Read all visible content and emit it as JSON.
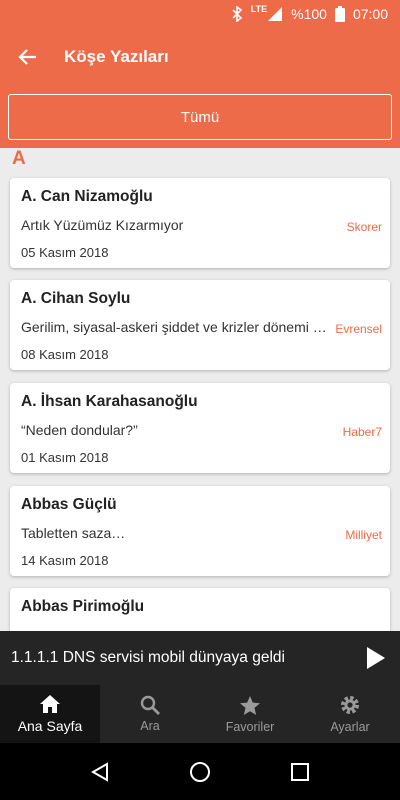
{
  "status_bar": {
    "network": "LTE",
    "battery": "%100",
    "time": "07:00"
  },
  "app_bar": {
    "title": "Köşe Yazıları",
    "back_icon": "arrow-back-icon"
  },
  "filter": {
    "label": "Tümü"
  },
  "section": {
    "letter": "A"
  },
  "columns": [
    {
      "author": "A. Can Nizamoğlu",
      "headline": "Artık Yüzümüz Kızarmıyor",
      "source": "Skorer",
      "date": "05 Kasım 2018"
    },
    {
      "author": "A. Cihan Soylu",
      "headline": "Gerilim, siyasal-askeri şiddet ve krizler dönemi …",
      "source": "Evrensel",
      "date": "08 Kasım 2018"
    },
    {
      "author": "A. İhsan Karahasanoğlu",
      "headline": "“Neden dondular?”",
      "source": "Haber7",
      "date": "01 Kasım 2018"
    },
    {
      "author": "Abbas Güçlü",
      "headline": "Tabletten saza…",
      "source": "Milliyet",
      "date": "14 Kasım 2018"
    },
    {
      "author": "Abbas Pirimoğlu",
      "headline": "",
      "source": "",
      "date": ""
    }
  ],
  "player": {
    "title": "1.1.1.1 DNS servisi mobil dünyaya geldi",
    "play_icon": "play-icon"
  },
  "bottom_nav": [
    {
      "label": "Ana Sayfa",
      "icon": "home-icon",
      "active": true
    },
    {
      "label": "Ara",
      "icon": "search-icon",
      "active": false
    },
    {
      "label": "Favoriler",
      "icon": "star-icon",
      "active": false
    },
    {
      "label": "Ayarlar",
      "icon": "gear-icon",
      "active": false
    }
  ],
  "colors": {
    "accent": "#ee6b4a",
    "dark_bar": "#252525",
    "background": "#ececec"
  }
}
